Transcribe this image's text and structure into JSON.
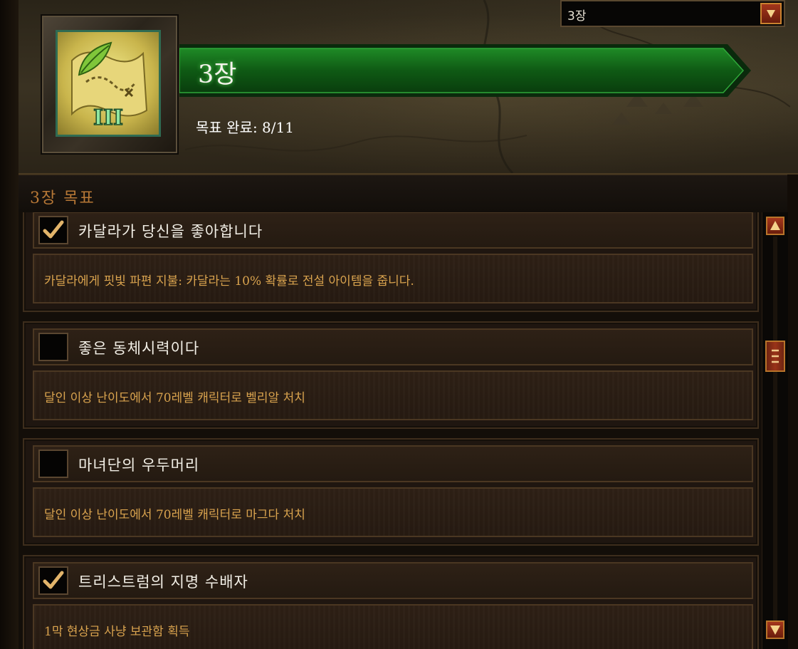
{
  "chapter_select": {
    "value": "3장"
  },
  "header": {
    "title": "3장",
    "progress": "목표 완료: 8/11",
    "badge_numeral": "III"
  },
  "section": {
    "title": "3장 목표"
  },
  "objectives": [
    {
      "title": "카달라가 당신을 좋아합니다",
      "description": "카달라에게 핏빛 파편 지불: 카달라는 10% 확률로 전설 아이템을 줍니다.",
      "completed": true
    },
    {
      "title": "좋은 동체시력이다",
      "description": "달인 이상 난이도에서 70레벨 캐릭터로 벨리알 처치",
      "completed": false
    },
    {
      "title": "마녀단의 우두머리",
      "description": "달인 이상 난이도에서 70레벨 캐릭터로 마그다 처치",
      "completed": false
    },
    {
      "title": "트리스트럼의 지명 수배자",
      "description": "1막 현상금 사냥 보관함 획득",
      "completed": true
    }
  ],
  "colors": {
    "title_glow": "#5fe05f",
    "description": "#d9a34e",
    "section_title": "#b77836",
    "button_red": "#a4361c",
    "banner_green": "#0f5a14"
  },
  "icons": {
    "dropdown": "arrow-down-icon",
    "checkbox_checked": "checkmark-icon",
    "badge": "leaf-map-icon",
    "scroll_up": "arrow-up-icon",
    "scroll_down": "arrow-down-icon"
  }
}
